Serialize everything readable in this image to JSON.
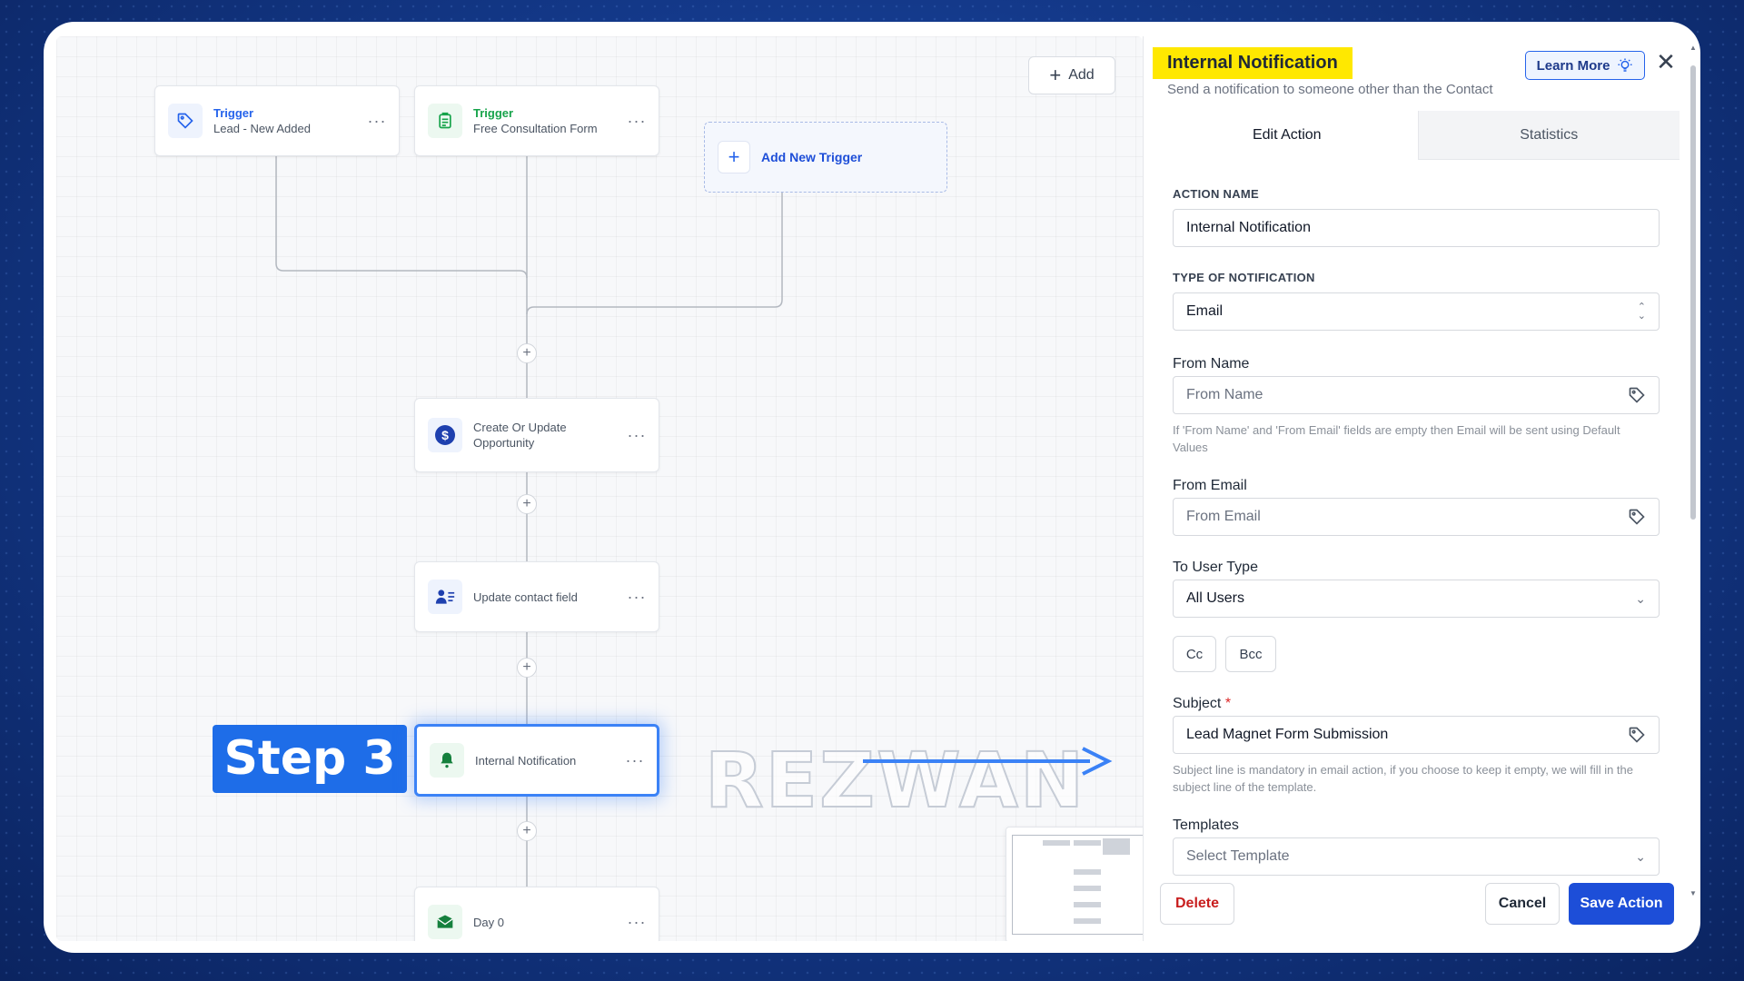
{
  "canvas": {
    "add_button": "Add",
    "add_new_trigger": "Add New Trigger",
    "triggers": [
      {
        "title": "Trigger",
        "subtitle": "Lead - New Added",
        "icon": "tag-icon",
        "color": "#2563eb"
      },
      {
        "title": "Trigger",
        "subtitle": "Free Consultation Form",
        "icon": "clipboard-icon",
        "color": "#16a34a"
      }
    ],
    "actions": [
      {
        "label_line1": "Create Or Update",
        "label_line2": "Opportunity",
        "icon": "dollar-icon"
      },
      {
        "label": "Update contact field",
        "icon": "contact-icon"
      },
      {
        "label": "Internal Notification",
        "icon": "bell-icon"
      },
      {
        "label": "Day 0",
        "icon": "email-icon"
      }
    ],
    "more_glyph": "···",
    "plus_glyph": "+",
    "step_label": "Step 3",
    "watermark": "REZWAN"
  },
  "panel": {
    "title": "Internal Notification",
    "subtitle": "Send a notification to someone other than the Contact",
    "learn_more": "Learn More",
    "close": "✕",
    "tabs": [
      {
        "label": "Edit Action",
        "active": true
      },
      {
        "label": "Statistics",
        "active": false
      }
    ],
    "action_name_label": "ACTION NAME",
    "action_name_value": "Internal Notification",
    "type_label": "TYPE OF NOTIFICATION",
    "type_value": "Email",
    "from_name_label": "From Name",
    "from_name_placeholder": "From Name",
    "from_help": "If 'From Name' and 'From Email' fields are empty then Email will be sent using Default Values",
    "from_email_label": "From Email",
    "from_email_placeholder": "From Email",
    "to_user_type_label": "To User Type",
    "to_user_type_value": "All Users",
    "cc": "Cc",
    "bcc": "Bcc",
    "subject_label": "Subject",
    "subject_required": "*",
    "subject_value": "Lead Magnet Form Submission",
    "subject_help": "Subject line is mandatory in email action, if you choose to keep it empty, we will fill in the subject line of the template.",
    "templates_label": "Templates",
    "templates_placeholder": "Select Template",
    "delete": "Delete",
    "cancel": "Cancel",
    "save": "Save Action"
  },
  "colors": {
    "accent": "#1d4ed8",
    "highlight": "#ffe800",
    "danger": "#c81e1e"
  }
}
